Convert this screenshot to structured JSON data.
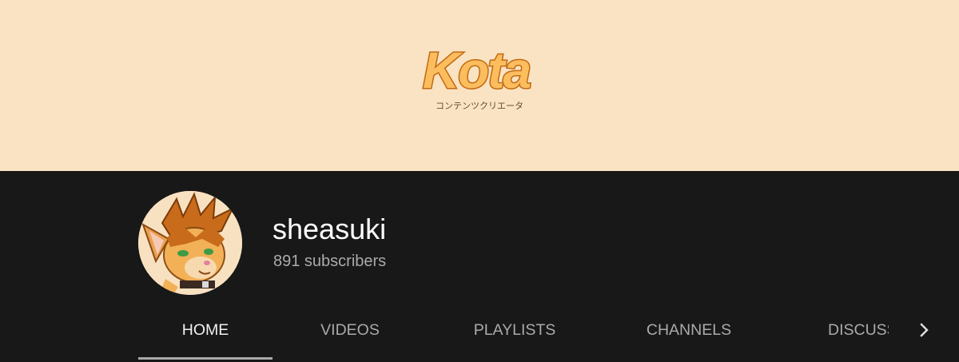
{
  "banner": {
    "logo_text": "Kota",
    "logo_subtitle": "コンテンツクリエータ",
    "background_color": "#f9e3c3",
    "logo_color": "#fbbd5e",
    "logo_outline_color": "#c26a12"
  },
  "channel": {
    "name": "sheasuki",
    "subscribers": "891 subscribers",
    "avatar_icon": "fox-avatar-icon"
  },
  "tabs": [
    {
      "label": "HOME",
      "active": true
    },
    {
      "label": "VIDEOS",
      "active": false
    },
    {
      "label": "PLAYLISTS",
      "active": false
    },
    {
      "label": "CHANNELS",
      "active": false
    },
    {
      "label": "DISCUSSION",
      "active": false
    }
  ],
  "scroll_right_icon": "chevron-right-icon",
  "colors": {
    "page_background": "#181818",
    "text_primary": "#ffffff",
    "text_secondary": "#aaaaaa"
  }
}
